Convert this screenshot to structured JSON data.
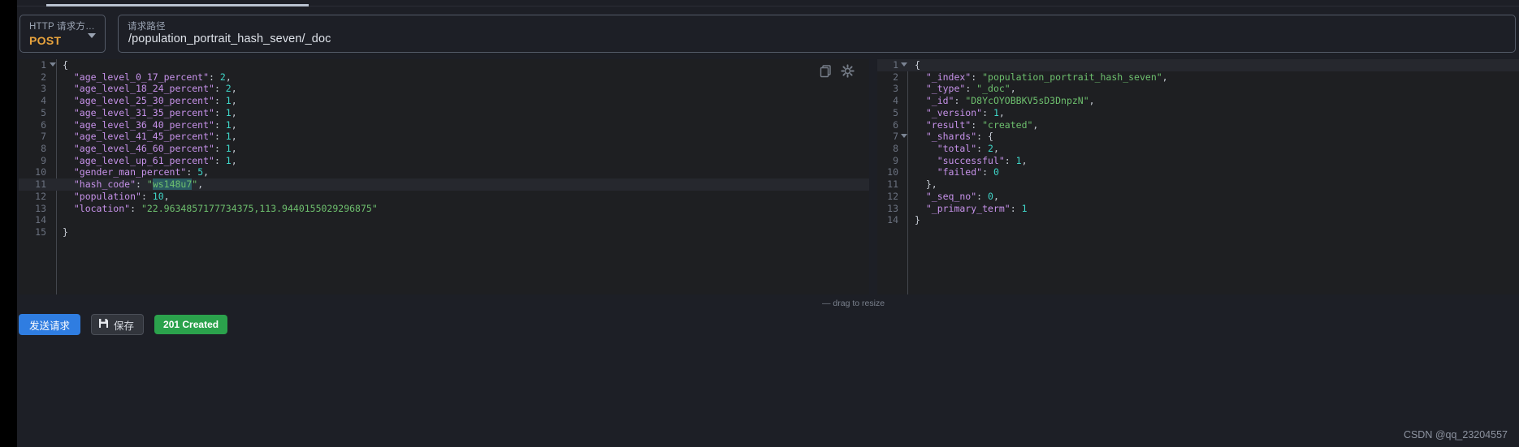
{
  "window": {
    "background": "#1d1f26",
    "editor_background": "#1e1f22"
  },
  "request_bar": {
    "method_label": "HTTP 请求方…",
    "method_value": "POST",
    "method_color": "#e8a33d",
    "path_label": "请求路径",
    "path_value": "/population_portrait_hash_seven/_doc"
  },
  "editor_toolbar": {
    "copy_icon": "copy-icon",
    "settings_icon": "gear-icon"
  },
  "request_editor": {
    "current_line": 11,
    "lines": [
      {
        "no": 1,
        "fold": true,
        "tokens": [
          {
            "t": "{",
            "c": "p"
          }
        ]
      },
      {
        "no": 2,
        "tokens": [
          {
            "t": "  \"age_level_0_17_percent\"",
            "c": "k"
          },
          {
            "t": ": ",
            "c": "p"
          },
          {
            "t": "2",
            "c": "n"
          },
          {
            "t": ",",
            "c": "p"
          }
        ]
      },
      {
        "no": 3,
        "tokens": [
          {
            "t": "  \"age_level_18_24_percent\"",
            "c": "k"
          },
          {
            "t": ": ",
            "c": "p"
          },
          {
            "t": "2",
            "c": "n"
          },
          {
            "t": ",",
            "c": "p"
          }
        ]
      },
      {
        "no": 4,
        "tokens": [
          {
            "t": "  \"age_level_25_30_percent\"",
            "c": "k"
          },
          {
            "t": ": ",
            "c": "p"
          },
          {
            "t": "1",
            "c": "n"
          },
          {
            "t": ",",
            "c": "p"
          }
        ]
      },
      {
        "no": 5,
        "tokens": [
          {
            "t": "  \"age_level_31_35_percent\"",
            "c": "k"
          },
          {
            "t": ": ",
            "c": "p"
          },
          {
            "t": "1",
            "c": "n"
          },
          {
            "t": ",",
            "c": "p"
          }
        ]
      },
      {
        "no": 6,
        "tokens": [
          {
            "t": "  \"age_level_36_40_percent\"",
            "c": "k"
          },
          {
            "t": ": ",
            "c": "p"
          },
          {
            "t": "1",
            "c": "n"
          },
          {
            "t": ",",
            "c": "p"
          }
        ]
      },
      {
        "no": 7,
        "tokens": [
          {
            "t": "  \"age_level_41_45_percent\"",
            "c": "k"
          },
          {
            "t": ": ",
            "c": "p"
          },
          {
            "t": "1",
            "c": "n"
          },
          {
            "t": ",",
            "c": "p"
          }
        ]
      },
      {
        "no": 8,
        "tokens": [
          {
            "t": "  \"age_level_46_60_percent\"",
            "c": "k"
          },
          {
            "t": ": ",
            "c": "p"
          },
          {
            "t": "1",
            "c": "n"
          },
          {
            "t": ",",
            "c": "p"
          }
        ]
      },
      {
        "no": 9,
        "tokens": [
          {
            "t": "  \"age_level_up_61_percent\"",
            "c": "k"
          },
          {
            "t": ": ",
            "c": "p"
          },
          {
            "t": "1",
            "c": "n"
          },
          {
            "t": ",",
            "c": "p"
          }
        ]
      },
      {
        "no": 10,
        "tokens": [
          {
            "t": "  \"gender_man_percent\"",
            "c": "k"
          },
          {
            "t": ": ",
            "c": "p"
          },
          {
            "t": "5",
            "c": "n"
          },
          {
            "t": ",",
            "c": "p"
          }
        ]
      },
      {
        "no": 11,
        "tokens": [
          {
            "t": "  \"hash_code\"",
            "c": "k"
          },
          {
            "t": ": ",
            "c": "p"
          },
          {
            "t": "\"",
            "c": "s"
          },
          {
            "t": "ws148u7",
            "c": "sel"
          },
          {
            "t": "\"",
            "c": "s"
          },
          {
            "t": ",",
            "c": "p"
          }
        ]
      },
      {
        "no": 12,
        "tokens": [
          {
            "t": "  \"population\"",
            "c": "k"
          },
          {
            "t": ": ",
            "c": "p"
          },
          {
            "t": "10",
            "c": "n"
          },
          {
            "t": ",",
            "c": "p"
          }
        ]
      },
      {
        "no": 13,
        "tokens": [
          {
            "t": "  \"location\"",
            "c": "k"
          },
          {
            "t": ": ",
            "c": "p"
          },
          {
            "t": "\"22.9634857177734375,113.9440155029296875\"",
            "c": "s"
          }
        ]
      },
      {
        "no": 14,
        "tokens": []
      },
      {
        "no": 15,
        "tokens": [
          {
            "t": "}",
            "c": "p"
          }
        ]
      }
    ]
  },
  "response_editor": {
    "current_line": 1,
    "lines": [
      {
        "no": 1,
        "fold": true,
        "tokens": [
          {
            "t": "{",
            "c": "p"
          }
        ]
      },
      {
        "no": 2,
        "tokens": [
          {
            "t": "  \"_index\"",
            "c": "k"
          },
          {
            "t": ": ",
            "c": "p"
          },
          {
            "t": "\"population_portrait_hash_seven\"",
            "c": "s"
          },
          {
            "t": ",",
            "c": "p"
          }
        ]
      },
      {
        "no": 3,
        "tokens": [
          {
            "t": "  \"_type\"",
            "c": "k"
          },
          {
            "t": ": ",
            "c": "p"
          },
          {
            "t": "\"_doc\"",
            "c": "s"
          },
          {
            "t": ",",
            "c": "p"
          }
        ]
      },
      {
        "no": 4,
        "tokens": [
          {
            "t": "  \"_id\"",
            "c": "k"
          },
          {
            "t": ": ",
            "c": "p"
          },
          {
            "t": "\"D8YcOYOBBKV5sD3DnpzN\"",
            "c": "s"
          },
          {
            "t": ",",
            "c": "p"
          }
        ]
      },
      {
        "no": 5,
        "tokens": [
          {
            "t": "  \"_version\"",
            "c": "k"
          },
          {
            "t": ": ",
            "c": "p"
          },
          {
            "t": "1",
            "c": "n"
          },
          {
            "t": ",",
            "c": "p"
          }
        ]
      },
      {
        "no": 6,
        "tokens": [
          {
            "t": "  \"result\"",
            "c": "k"
          },
          {
            "t": ": ",
            "c": "p"
          },
          {
            "t": "\"created\"",
            "c": "s"
          },
          {
            "t": ",",
            "c": "p"
          }
        ]
      },
      {
        "no": 7,
        "fold": true,
        "tokens": [
          {
            "t": "  \"_shards\"",
            "c": "k"
          },
          {
            "t": ": {",
            "c": "p"
          }
        ]
      },
      {
        "no": 8,
        "tokens": [
          {
            "t": "    \"total\"",
            "c": "k"
          },
          {
            "t": ": ",
            "c": "p"
          },
          {
            "t": "2",
            "c": "n"
          },
          {
            "t": ",",
            "c": "p"
          }
        ]
      },
      {
        "no": 9,
        "tokens": [
          {
            "t": "    \"successful\"",
            "c": "k"
          },
          {
            "t": ": ",
            "c": "p"
          },
          {
            "t": "1",
            "c": "n"
          },
          {
            "t": ",",
            "c": "p"
          }
        ]
      },
      {
        "no": 10,
        "tokens": [
          {
            "t": "    \"failed\"",
            "c": "k"
          },
          {
            "t": ": ",
            "c": "p"
          },
          {
            "t": "0",
            "c": "n"
          }
        ]
      },
      {
        "no": 11,
        "tokens": [
          {
            "t": "  },",
            "c": "p"
          }
        ]
      },
      {
        "no": 12,
        "tokens": [
          {
            "t": "  \"_seq_no\"",
            "c": "k"
          },
          {
            "t": ": ",
            "c": "p"
          },
          {
            "t": "0",
            "c": "n"
          },
          {
            "t": ",",
            "c": "p"
          }
        ]
      },
      {
        "no": 13,
        "tokens": [
          {
            "t": "  \"_primary_term\"",
            "c": "k"
          },
          {
            "t": ": ",
            "c": "p"
          },
          {
            "t": "1",
            "c": "n"
          }
        ]
      },
      {
        "no": 14,
        "tokens": [
          {
            "t": "}",
            "c": "p"
          }
        ]
      }
    ]
  },
  "resize_hint": "— drag to resize",
  "footer": {
    "send_label": "发送请求",
    "send_color": "#2f7de1",
    "save_label": "保存",
    "save_icon": "floppy-disk-icon",
    "status_label": "201 Created",
    "status_color": "#2ba24c"
  },
  "watermark": "CSDN @qq_23204557"
}
